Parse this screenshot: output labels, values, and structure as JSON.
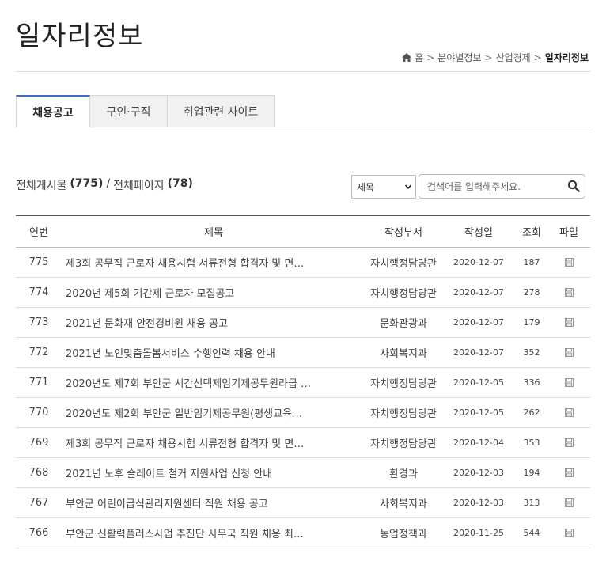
{
  "page": {
    "title": "일자리정보"
  },
  "breadcrumb": {
    "home": "홈",
    "level1": "분야별정보",
    "level2": "산업경제",
    "current": "일자리정보",
    "separator": ">"
  },
  "tabs": [
    {
      "label": "채용공고",
      "active": true
    },
    {
      "label": "구인·구직",
      "active": false
    },
    {
      "label": "취업관련 사이트",
      "active": false
    }
  ],
  "summary": {
    "total_label": "전체게시물",
    "total": "(775)",
    "divider": "/",
    "pages_label": "전체페이지",
    "pages": "(78)"
  },
  "search": {
    "select_value": "제목",
    "placeholder": "검색어를 입력해주세요."
  },
  "table": {
    "headers": {
      "num": "연번",
      "title": "제목",
      "dept": "작성부서",
      "date": "작성일",
      "views": "조회",
      "file": "파일"
    },
    "rows": [
      {
        "num": "775",
        "title": "제3회 공무직 근로자 채용시험 서류전형 합격자 및 면…",
        "dept": "자치행정담당관",
        "date": "2020-12-07",
        "views": "187"
      },
      {
        "num": "774",
        "title": "2020년 제5회 기간제 근로자 모집공고",
        "dept": "자치행정담당관",
        "date": "2020-12-07",
        "views": "278"
      },
      {
        "num": "773",
        "title": "2021년 문화재 안전경비원 채용 공고",
        "dept": "문화관광과",
        "date": "2020-12-07",
        "views": "179"
      },
      {
        "num": "772",
        "title": "2021년 노인맞춤돌봄서비스 수행인력 채용 안내",
        "dept": "사회복지과",
        "date": "2020-12-07",
        "views": "352"
      },
      {
        "num": "771",
        "title": "2020년도 제7회 부안군 시간선택제임기제공무원라급 …",
        "dept": "자치행정담당관",
        "date": "2020-12-05",
        "views": "336"
      },
      {
        "num": "770",
        "title": "2020년도 제2회 부안군 일반임기제공무원(평생교육…",
        "dept": "자치행정담당관",
        "date": "2020-12-05",
        "views": "262"
      },
      {
        "num": "769",
        "title": "제3회 공무직 근로자 채용시험 서류전형 합격자 및 면…",
        "dept": "자치행정담당관",
        "date": "2020-12-04",
        "views": "353"
      },
      {
        "num": "768",
        "title": "2021년 노후 슬레이트 철거 지원사업 신청 안내",
        "dept": "환경과",
        "date": "2020-12-03",
        "views": "194"
      },
      {
        "num": "767",
        "title": "부안군 어린이급식관리지원센터 직원 채용 공고",
        "dept": "사회복지과",
        "date": "2020-12-03",
        "views": "313"
      },
      {
        "num": "766",
        "title": "부안군 신활력플러스사업 추진단 사무국 직원 채용 최…",
        "dept": "농업정책과",
        "date": "2020-11-25",
        "views": "544"
      }
    ]
  },
  "icons": {
    "home": "home-icon",
    "search": "search-icon",
    "file": "file-icon",
    "dropdown": "chevron-down-icon"
  },
  "colors": {
    "tab_active_border": "#3a6fb8",
    "tab_inactive_bg": "#f1f1f1"
  }
}
